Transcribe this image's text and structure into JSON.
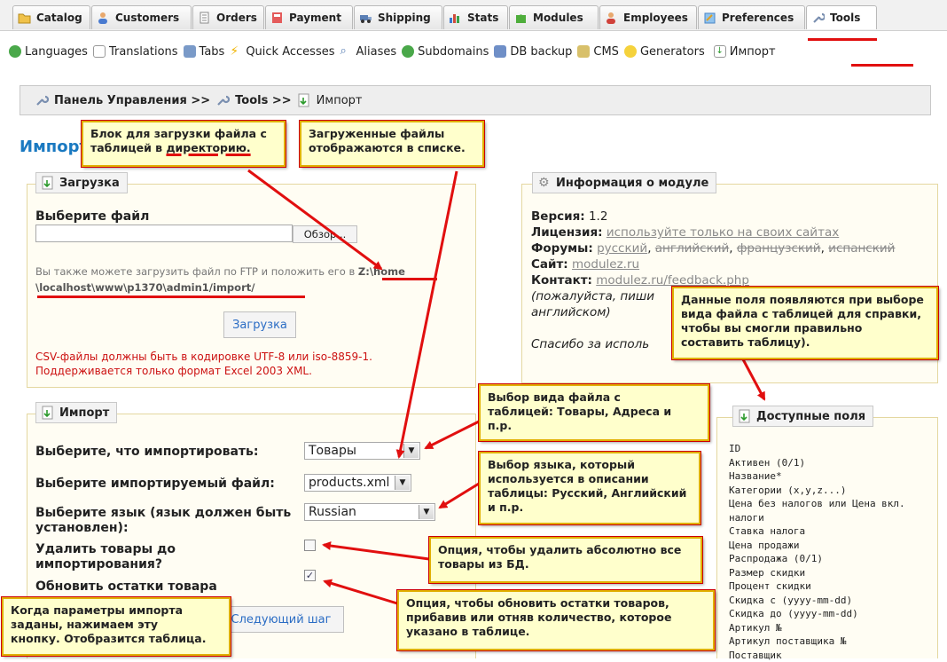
{
  "tabs": [
    {
      "label": "Catalog",
      "icon": "folder-icon"
    },
    {
      "label": "Customers",
      "icon": "user-icon"
    },
    {
      "label": "Orders",
      "icon": "document-icon"
    },
    {
      "label": "Payment",
      "icon": "calculator-icon"
    },
    {
      "label": "Shipping",
      "icon": "truck-icon"
    },
    {
      "label": "Stats",
      "icon": "chart-icon"
    },
    {
      "label": "Modules",
      "icon": "puzzle-icon"
    },
    {
      "label": "Employees",
      "icon": "employees-icon"
    },
    {
      "label": "Preferences",
      "icon": "preferences-icon"
    },
    {
      "label": "Tools",
      "icon": "wrench-icon"
    }
  ],
  "submenu": [
    {
      "label": "Languages",
      "icon": "globe-icon"
    },
    {
      "label": "Translations",
      "icon": "translate-icon"
    },
    {
      "label": "Tabs",
      "icon": "tabs-icon"
    },
    {
      "label": "Quick Accesses",
      "icon": "lightning-icon"
    },
    {
      "label": "Aliases",
      "icon": "search-icon"
    },
    {
      "label": "Subdomains",
      "icon": "globe-icon"
    },
    {
      "label": "DB backup",
      "icon": "database-icon"
    },
    {
      "label": "CMS",
      "icon": "cms-icon"
    },
    {
      "label": "Generators",
      "icon": "bulb-icon"
    },
    {
      "label": "Импорт",
      "icon": "import-icon"
    }
  ],
  "breadcrumb": {
    "home": "Панель Управления",
    "sep1": ">>",
    "tools": "Tools",
    "sep2": ">>",
    "current": "Импорт"
  },
  "page_title": "Импорт",
  "upload": {
    "legend": "Загрузка",
    "choose_label": "Выберите файл",
    "browse_button": "Обзор...",
    "ftp_text": "Вы также можете загрузить файл по FTP и положить его в",
    "ftp_path_1": "Z:\\home",
    "ftp_path_2": "\\localhost\\www\\p1370\\admin1/import/",
    "upload_button": "Загрузка",
    "note_1": "CSV-файлы должны быть в кодировке UTF-8 или iso-8859-1.",
    "note_2": "Поддерживается только формат Excel 2003 XML."
  },
  "module_info": {
    "legend": "Информация о модуле",
    "version_label": "Версия:",
    "version": "1.2",
    "license_label": "Лицензия:",
    "license": "используйте только на своих сайтах",
    "forums_label": "Форумы:",
    "forums": [
      "русский",
      "английский",
      "французский",
      "испанский"
    ],
    "site_label": "Сайт:",
    "site": "modulez.ru",
    "contact_label": "Контакт:",
    "contact": "modulez.ru/feedback.php",
    "contact_note_1": "(пожалуйста, пиши",
    "contact_note_2": "английском)",
    "thanks": "Спасибо за исполь"
  },
  "import_form": {
    "legend": "Импорт",
    "what_label": "Выберите, что импортировать:",
    "what_value": "Товары",
    "file_label": "Выберите импортируемый файл:",
    "file_value": "products.xml",
    "lang_label_1": "Выберите язык (язык должен быть",
    "lang_label_2": "установлен):",
    "lang_value": "Russian",
    "delete_label_1": "Удалить товары до",
    "delete_label_2": "импортирования?",
    "delete_checked": false,
    "update_label": "Обновить остатки товара",
    "update_checked": true,
    "next_button": "Следующий шаг"
  },
  "fields": {
    "legend": "Доступные поля",
    "items": [
      "ID",
      "Активен (0/1)",
      "Название*",
      "Категории (x,y,z...)",
      "Цена без налогов или Цена вкл.",
      "налоги",
      "Ставка налога",
      "Цена продажи",
      "Распродажа (0/1)",
      "Размер скидки",
      "Процент скидки",
      "Скидка с (yyyy-mm-dd)",
      "Скидка до (yyyy-mm-dd)",
      "Артикул №",
      "Артикул поставщика №",
      "Поставщик"
    ]
  },
  "callouts": {
    "c1_a": "Блок для загрузки файла с",
    "c1_b": "таблицей в ",
    "c1_c": "директорию.",
    "c2_a": "Загруженные файлы",
    "c2_b": "отображаются в списке.",
    "c3_a": "Данные поля появляются при выборе",
    "c3_b": "вида файла с таблицей для справки,",
    "c3_c": "чтобы вы смогли правильно",
    "c3_d": "составить таблицу).",
    "c4_a": "Выбор вида файла с",
    "c4_b": "таблицей: Товары, Адреса и",
    "c4_c": "п.р.",
    "c5_a": "Выбор языка, который",
    "c5_b": "используется в описании",
    "c5_c": "таблицы: Русский, Английский",
    "c5_d": "и п.р.",
    "c6_a": "Опция, чтобы удалить абсолютно все",
    "c6_b": "товары из БД.",
    "c7_a": "Опция, чтобы обновить остатки товаров,",
    "c7_b": "прибавив или отняв количество, которое",
    "c7_c": "указано в таблице.",
    "c8_a": "Когда параметры импорта",
    "c8_b": "заданы, нажимаем эту",
    "c8_c": "кнопку. Отобразится таблица."
  },
  "colors": {
    "accent": "#1a79c1",
    "callout_bg": "#ffffcc",
    "callout_border": "#e0b000",
    "arrow": "#e10f0f",
    "note_red": "#cc1111"
  }
}
